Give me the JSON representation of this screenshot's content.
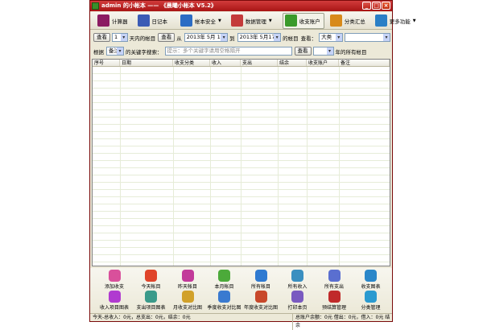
{
  "window": {
    "title": "admin 的小帐本 —— 《晨曦小帐本 V5.2》"
  },
  "toolbar": {
    "items": [
      {
        "label": "计算器",
        "icon": "calculator-icon",
        "color": "#8b1c62",
        "dropdown": false,
        "active": false
      },
      {
        "label": "日记本",
        "icon": "diary-icon",
        "color": "#3b5bb5",
        "dropdown": false,
        "active": false
      },
      {
        "label": "帐本安全",
        "icon": "safe-icon",
        "color": "#2c6cc4",
        "dropdown": true,
        "active": false
      },
      {
        "label": "数据管理",
        "icon": "data-icon",
        "color": "#c43b3b",
        "dropdown": true,
        "active": false
      },
      {
        "label": "收支账户",
        "icon": "account-icon",
        "color": "#3a9a2a",
        "dropdown": false,
        "active": true
      },
      {
        "label": "分类汇总",
        "icon": "summary-icon",
        "color": "#d88a1a",
        "dropdown": false,
        "active": false
      },
      {
        "label": "更多功能",
        "icon": "more-icon",
        "color": "#2a7fc6",
        "dropdown": true,
        "active": false
      }
    ]
  },
  "filter1": {
    "view_btn": "查看",
    "days_value": "1",
    "days_suffix": "天内的帐目",
    "view_btn2": "查看",
    "from": "从",
    "start_date": "2013年 5月 1日",
    "to": "到",
    "end_date": "2013年 5月17日",
    "range_suffix": "的帐目",
    "view_label": "查看：",
    "type_value": "大类",
    "sub_value": ""
  },
  "filter2": {
    "by": "根据",
    "field_value": "备注",
    "keyword_label": "的关键字搜索：",
    "keyword_placeholder": "提示：多个关键字请用空格隔开",
    "view_btn": "查看",
    "year_value": "",
    "year_suffix": "年的所有帐目"
  },
  "grid": {
    "columns": [
      "序号",
      "日期",
      "收支分类",
      "收入",
      "支出",
      "结余",
      "收支账户",
      "备注"
    ],
    "rows": []
  },
  "bottom": {
    "row1": [
      {
        "label": "添加收支",
        "icon": "add-record-icon",
        "color": "#d9509b"
      },
      {
        "label": "今天帐目",
        "icon": "today-icon",
        "color": "#e0442a"
      },
      {
        "label": "昨天帐目",
        "icon": "yesterday-icon",
        "color": "#c23a9a"
      },
      {
        "label": "本月帐目",
        "icon": "month-icon",
        "color": "#4caa3a"
      },
      {
        "label": "所有帐目",
        "icon": "all-records-icon",
        "color": "#2f7ad1"
      },
      {
        "label": "所有收入",
        "icon": "all-income-icon",
        "color": "#3a8fc0"
      },
      {
        "label": "所有支出",
        "icon": "all-expense-icon",
        "color": "#5a6fd0"
      },
      {
        "label": "收支图表",
        "icon": "chart-icon",
        "color": "#2a87c9"
      }
    ],
    "row2": [
      {
        "label": "收入项目图表",
        "icon": "income-chart-icon",
        "color": "#b03ad0"
      },
      {
        "label": "支出项目图表",
        "icon": "expense-chart-icon",
        "color": "#3a9a8a"
      },
      {
        "label": "月收支对比图",
        "icon": "monthly-compare-icon",
        "color": "#d1a12a"
      },
      {
        "label": "季度收支对比图",
        "icon": "quarterly-compare-icon",
        "color": "#3a7ad0"
      },
      {
        "label": "年度收支对比图",
        "icon": "yearly-compare-icon",
        "color": "#c8482a"
      },
      {
        "label": "打印本页",
        "icon": "print-icon",
        "color": "#7a5ac0"
      },
      {
        "label": "预结算管理",
        "icon": "settle-icon",
        "color": "#c02a2a"
      },
      {
        "label": "分类管理",
        "icon": "category-icon",
        "color": "#2a9ad0"
      }
    ]
  },
  "status": {
    "left": "今天-总收入：0元，总支出：0元，结余：0元",
    "right": "总账户余额：0元  借出：0元，借入：0元  结余"
  }
}
